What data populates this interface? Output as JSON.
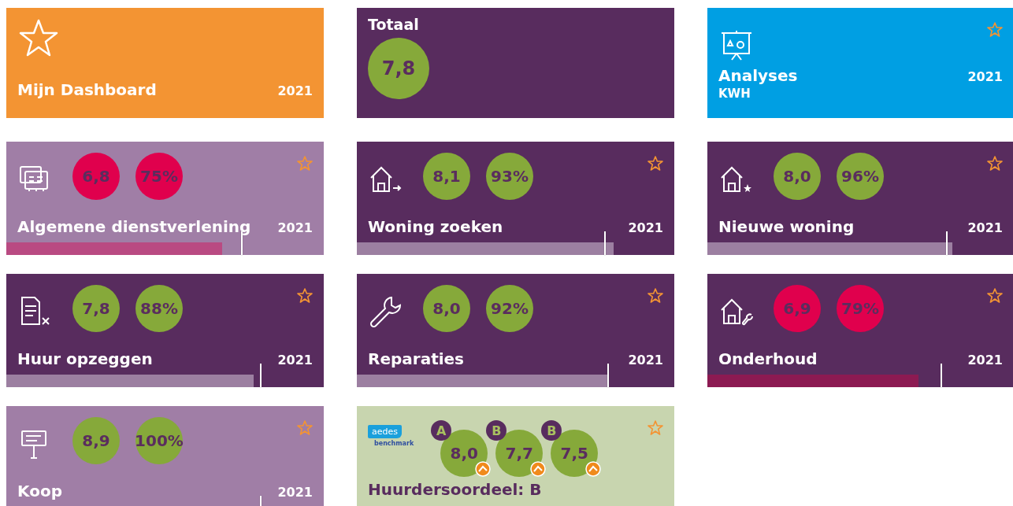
{
  "tiles": [
    {
      "kind": "dashboard",
      "title": "Mijn Dashboard",
      "year": "2021",
      "color": "#f39433"
    },
    {
      "kind": "total",
      "label": "Totaal",
      "grade": "7,8",
      "color": "#582c5e"
    },
    {
      "kind": "analyses",
      "title": "Analyses",
      "subtitle": "KWH",
      "year": "2021",
      "color": "#009fe3",
      "favorite": false
    },
    {
      "kind": "score",
      "title": "Algemene dienstverlening",
      "year": "2021",
      "color": "#a07ea6",
      "favorite": false,
      "badges": [
        {
          "text": "6,8",
          "color": "#e0004d"
        },
        {
          "text": "75%",
          "color": "#e0004d"
        }
      ],
      "level": 0.68,
      "target": {
        "level": 0.74
      },
      "below_target": true
    },
    {
      "kind": "score",
      "title": "Woning zoeken",
      "year": "2021",
      "color": "#582c5e",
      "favorite": false,
      "badges": [
        {
          "text": "8,1",
          "color": "#86a93a"
        },
        {
          "text": "93%",
          "color": "#86a93a"
        }
      ],
      "level": 0.81,
      "target": {
        "level": 0.78
      },
      "below_target": false
    },
    {
      "kind": "score",
      "title": "Nieuwe woning",
      "year": "2021",
      "color": "#582c5e",
      "favorite": false,
      "badges": [
        {
          "text": "8,0",
          "color": "#86a93a"
        },
        {
          "text": "96%",
          "color": "#86a93a"
        }
      ],
      "level": 0.8,
      "target": {
        "level": 0.78
      },
      "below_target": false
    },
    {
      "kind": "score",
      "title": "Huur opzeggen",
      "year": "2021",
      "color": "#582c5e",
      "favorite": false,
      "badges": [
        {
          "text": "7,8",
          "color": "#86a93a"
        },
        {
          "text": "88%",
          "color": "#86a93a"
        }
      ],
      "level": 0.78,
      "target": {
        "level": 0.8
      },
      "below_target": false
    },
    {
      "kind": "score",
      "title": "Reparaties",
      "year": "2021",
      "color": "#582c5e",
      "favorite": false,
      "badges": [
        {
          "text": "8,0",
          "color": "#86a93a"
        },
        {
          "text": "92%",
          "color": "#86a93a"
        }
      ],
      "level": 0.79,
      "target": {
        "level": 0.79
      },
      "below_target": false
    },
    {
      "kind": "score",
      "title": "Onderhoud",
      "year": "2021",
      "color": "#582c5e",
      "favorite": false,
      "badges": [
        {
          "text": "6,9",
          "color": "#e0004d"
        },
        {
          "text": "79%",
          "color": "#e0004d"
        }
      ],
      "level": 0.69,
      "target": {
        "level": 0.76
      },
      "below_target": true
    },
    {
      "kind": "score",
      "title": "Koop",
      "year": "2021",
      "color": "#a07ea6",
      "favorite": false,
      "badges": [
        {
          "text": "8,9",
          "color": "#86a93a"
        },
        {
          "text": "100%",
          "color": "#86a93a"
        }
      ],
      "target": {
        "level": 0.8
      }
    },
    {
      "kind": "benchmark",
      "logo_text": "aedes",
      "logo_subtext": "benchmark",
      "title": "Huurdersoordeel: B",
      "color": "#c8d5af",
      "favorite": false,
      "scores": [
        {
          "letter": "A",
          "grade": "8,0"
        },
        {
          "letter": "B",
          "grade": "7,7"
        },
        {
          "letter": "B",
          "grade": "7,5"
        }
      ]
    }
  ]
}
